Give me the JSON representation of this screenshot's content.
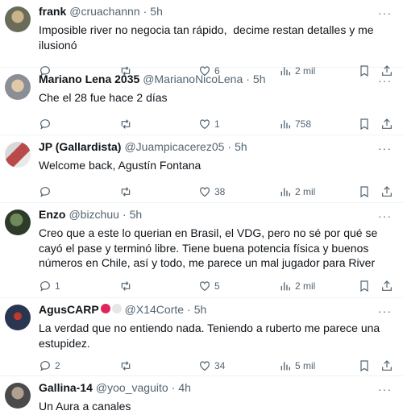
{
  "tweets": [
    {
      "name": "frank",
      "handle": "@cruachannn",
      "time": "5h",
      "text": "Imposible river no negocia tan rápido,  decime restan detalles y me ilusionó",
      "replies": "",
      "reposts": "",
      "likes": "6",
      "views": "2 mil",
      "avatar_color": "#6b6b5a"
    },
    {
      "name": "Mariano Lena 2035",
      "handle": "@MarianoNicoLena",
      "time": "5h",
      "text": "Che el 28 fue hace 2 días",
      "replies": "",
      "reposts": "",
      "likes": "1",
      "views": "758",
      "avatar_color": "#8a8f95"
    },
    {
      "name": "JP (Gallardista)",
      "handle": "@Juampicacerez05",
      "time": "5h",
      "text": "Welcome back, Agustín Fontana",
      "replies": "",
      "reposts": "",
      "likes": "38",
      "views": "2 mil",
      "avatar_color": "#b84a4a"
    },
    {
      "name": "Enzo",
      "handle": "@bizchuu",
      "time": "5h",
      "text": "Creo que a este lo querian en Brasil, el VDG, pero no sé por qué se cayó el pase y terminó libre. Tiene buena potencia física y buenos números en Chile, así y todo, me parece un mal jugador para River",
      "replies": "1",
      "reposts": "",
      "likes": "5",
      "views": "2 mil",
      "avatar_color": "#2e3b2a"
    },
    {
      "name": "AgusCARP",
      "handle": "@X14Corte",
      "time": "5h",
      "text": "La verdad que no entiendo nada. Teniendo a ruberto me parece una estupidez.",
      "replies": "2",
      "reposts": "",
      "likes": "34",
      "views": "5 mil",
      "avatar_color": "#2a3550"
    },
    {
      "name": "Gallina-14",
      "handle": "@yoo_vaguito",
      "time": "4h",
      "text": "Un Aura a canales",
      "replies": "",
      "reposts": "",
      "likes": "",
      "views": "",
      "avatar_color": "#4a4a4a"
    }
  ],
  "icons": {
    "reply": "reply-icon",
    "repost": "repost-icon",
    "like": "heart-icon",
    "views": "views-icon",
    "bookmark": "bookmark-icon",
    "share": "share-icon",
    "more": "more-icon"
  },
  "colors": {
    "text": "#0f1419",
    "secondary": "#536471",
    "border": "#eff3f4",
    "flag_red": "#e0245e",
    "flag_white": "#e6e6e6"
  }
}
